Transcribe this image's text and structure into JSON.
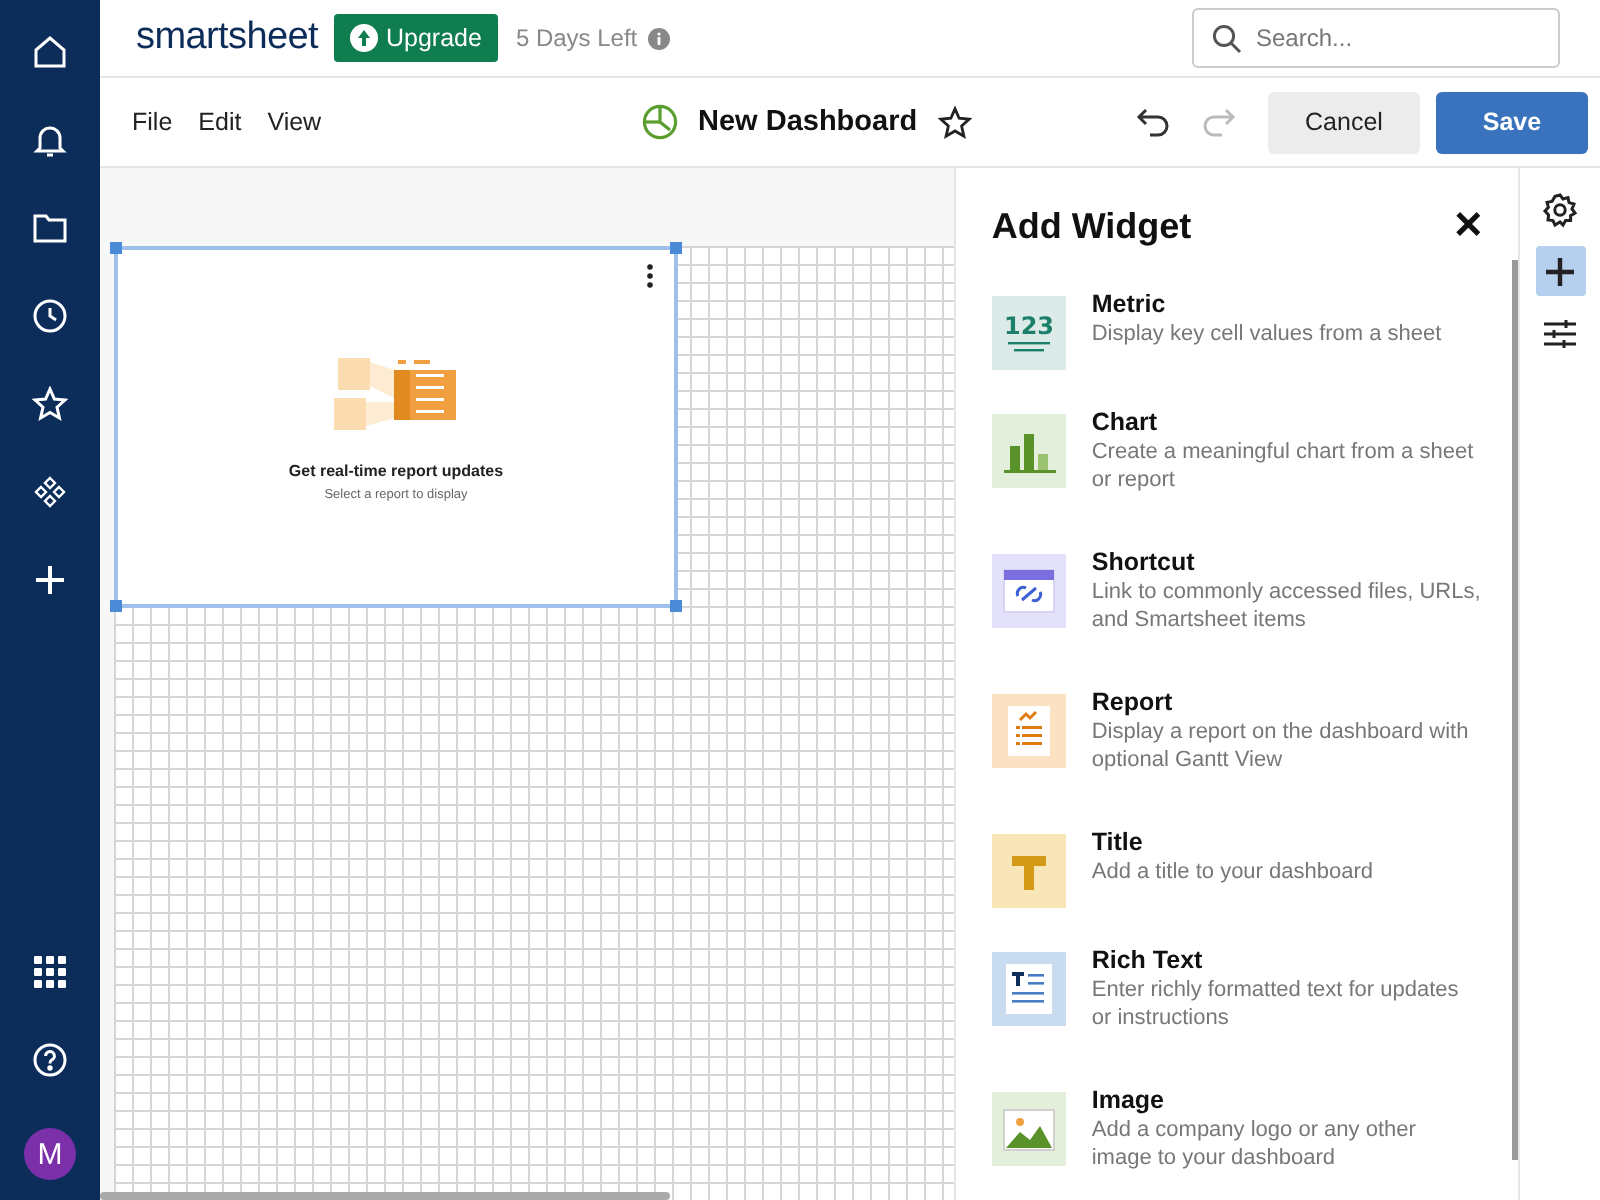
{
  "nav": {
    "items": [
      {
        "kind": "home"
      },
      {
        "kind": "bell"
      },
      {
        "kind": "folder"
      },
      {
        "kind": "clock"
      },
      {
        "kind": "star"
      },
      {
        "kind": "diamonds"
      },
      {
        "kind": "plus"
      }
    ],
    "bottom": [
      {
        "kind": "apps"
      },
      {
        "kind": "help"
      }
    ],
    "avatar": "M"
  },
  "header": {
    "logo": "smartsheet",
    "upgrade": "Upgrade",
    "trial": "5 Days Left",
    "search": {
      "placeholder": "Search..."
    }
  },
  "toolbar": {
    "menus": [
      "File",
      "Edit",
      "View"
    ],
    "title": "New Dashboard",
    "undo_disabled": false,
    "redo_disabled": true,
    "cancel": "Cancel",
    "save": "Save"
  },
  "widget": {
    "heading": "Get real-time report updates",
    "subtext": "Select a report to display"
  },
  "panel": {
    "title": "Add Widget",
    "close": "×",
    "widgets": [
      {
        "kind": "metric",
        "icon_text": "123",
        "name": "Metric",
        "description": "Display key cell values from a sheet"
      },
      {
        "kind": "chart",
        "name": "Chart",
        "description": "Create a meaningful chart from a sheet or report"
      },
      {
        "kind": "shortcut",
        "name": "Shortcut",
        "description": "Link to commonly accessed files, URLs, and Smartsheet items"
      },
      {
        "kind": "report",
        "name": "Report",
        "description": "Display a report on the dashboard with optional Gantt View"
      },
      {
        "kind": "title",
        "name": "Title",
        "description": "Add a title to your dashboard"
      },
      {
        "kind": "richtext",
        "name": "Rich Text",
        "description": "Enter richly formatted text for updates or instructions"
      },
      {
        "kind": "image",
        "name": "Image",
        "description": "Add a company logo or any other image to your dashboard"
      }
    ]
  },
  "rail": [
    {
      "kind": "settings",
      "selected": false
    },
    {
      "kind": "add",
      "selected": true
    },
    {
      "kind": "filters",
      "selected": false
    }
  ]
}
